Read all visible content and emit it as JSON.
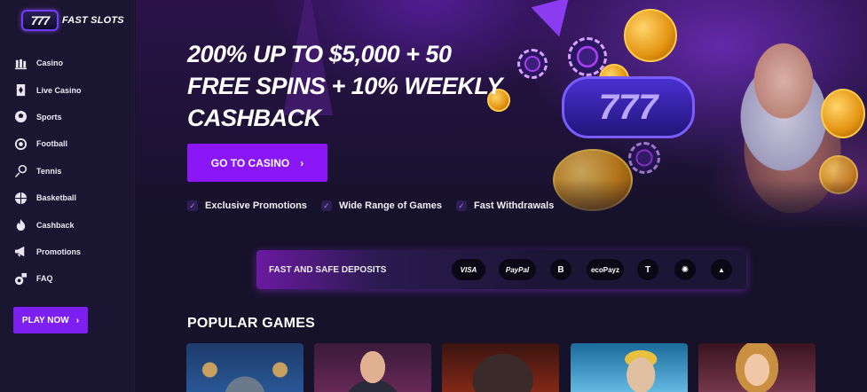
{
  "brand": {
    "logo_badge": "777",
    "logo_text": "FAST SLOTS"
  },
  "sidebar": {
    "items": [
      {
        "label": "Casino",
        "icon": "casino-icon"
      },
      {
        "label": "Live Casino",
        "icon": "cards-icon"
      },
      {
        "label": "Sports",
        "icon": "sports-ball-icon"
      },
      {
        "label": "Football",
        "icon": "football-icon"
      },
      {
        "label": "Tennis",
        "icon": "tennis-icon"
      },
      {
        "label": "Basketball",
        "icon": "basketball-icon"
      },
      {
        "label": "Cashback",
        "icon": "fire-icon"
      },
      {
        "label": "Promotions",
        "icon": "megaphone-icon"
      },
      {
        "label": "FAQ",
        "icon": "faq-icon"
      }
    ],
    "play_now_label": "PLAY NOW"
  },
  "hero": {
    "headline": "200% UP TO $5,000 + 50 FREE SPINS + 10% WEEKLY CASHBACK",
    "cta_label": "GO TO CASINO",
    "features": [
      "Exclusive Promotions",
      "Wide Range of Games",
      "Fast Withdrawals"
    ],
    "slot_reels": "777"
  },
  "deposits": {
    "title": "FAST AND SAFE DEPOSITS",
    "methods": [
      {
        "label": "VISA",
        "icon": "visa-icon"
      },
      {
        "label": "PayPal",
        "icon": "paypal-icon"
      },
      {
        "label": "B",
        "icon": "bitcoin-icon"
      },
      {
        "label": "ecoPayz",
        "icon": "ecopayz-icon"
      },
      {
        "label": "T",
        "icon": "tether-icon"
      },
      {
        "label": "✺",
        "icon": "cardano-icon"
      },
      {
        "label": "▲",
        "icon": "tron-icon"
      }
    ]
  },
  "popular_games": {
    "title": "POPULAR GAMES",
    "games": [
      {
        "name": "viking-helmet-game",
        "colors": [
          "#1d3a6a",
          "#2a5a9a"
        ]
      },
      {
        "name": "live-dealer-man-game",
        "colors": [
          "#3a1a3a",
          "#6a2a5a"
        ]
      },
      {
        "name": "werewolf-game",
        "colors": [
          "#3a1410",
          "#8a2a18"
        ]
      },
      {
        "name": "poseidon-game",
        "colors": [
          "#1a6a9a",
          "#6ac0e8"
        ]
      },
      {
        "name": "live-dealer-woman-game",
        "colors": [
          "#3a1420",
          "#7a3a50"
        ]
      }
    ]
  },
  "colors": {
    "accent": "#8a16f5",
    "background": "#16122a",
    "sidebar": "#1a1530"
  }
}
